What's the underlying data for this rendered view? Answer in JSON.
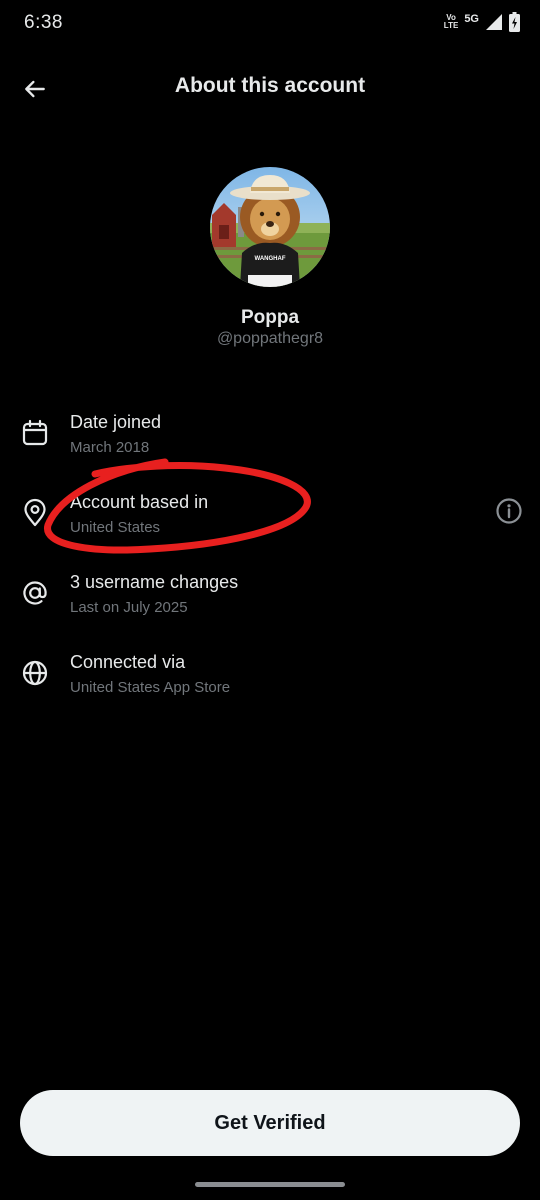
{
  "status_bar": {
    "time": "6:38",
    "volte_top": "Vo",
    "volte_bottom": "LTE",
    "network": "5G",
    "icons": [
      "volte-icon",
      "signal-icon",
      "battery-icon"
    ]
  },
  "header": {
    "back_icon": "arrow-left-icon",
    "title": "About this account"
  },
  "profile": {
    "display_name": "Poppa",
    "handle": "@poppathegr8",
    "avatar_shirt_text": "WANGHAF"
  },
  "info_rows": [
    {
      "icon": "calendar-icon",
      "title": "Date joined",
      "subtitle": "March 2018"
    },
    {
      "icon": "location-pin-icon",
      "title": "Account based in",
      "subtitle": "United States",
      "trailing_icon": "info-icon"
    },
    {
      "icon": "at-sign-icon",
      "title": "3 username changes",
      "subtitle": "Last on July 2025"
    },
    {
      "icon": "globe-icon",
      "title": "Connected via",
      "subtitle": "United States App Store"
    }
  ],
  "cta": {
    "label": "Get Verified"
  },
  "colors": {
    "background": "#000000",
    "text_primary": "#e7e9ea",
    "text_secondary": "#71767b",
    "button_bg": "#eff3f4",
    "annotation_red": "#e8201f"
  }
}
